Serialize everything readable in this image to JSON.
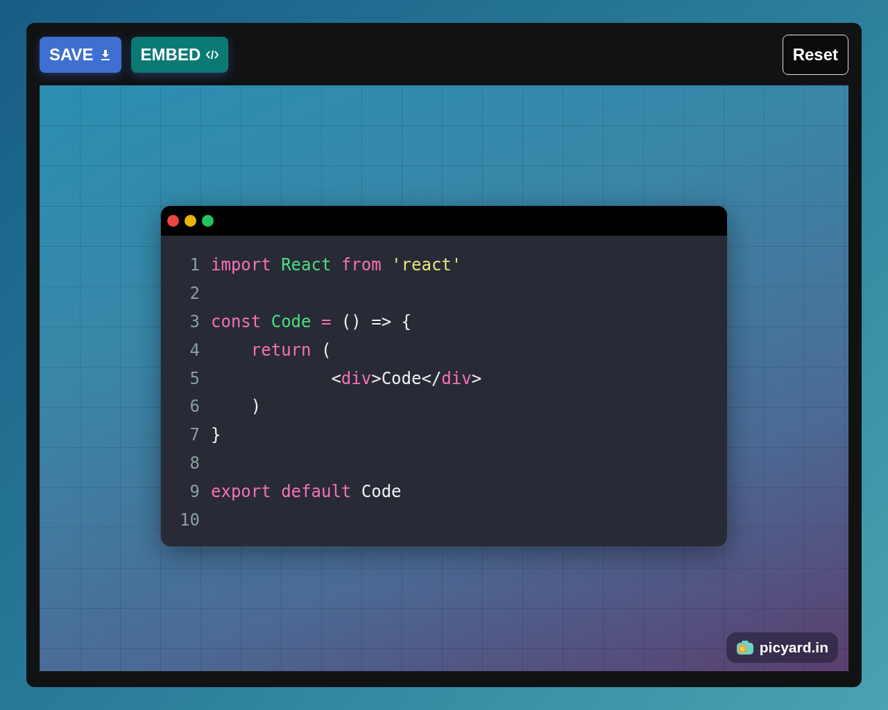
{
  "toolbar": {
    "buttons": [
      {
        "label": "SAVE",
        "kind": "save"
      },
      {
        "label": "EMBED",
        "kind": "embed"
      }
    ],
    "reset": "Reset"
  },
  "code_window": {
    "lines": [
      {
        "number": "1",
        "tokens": [
          {
            "kind": "keyword",
            "text": "import "
          },
          {
            "kind": "name",
            "text": "React "
          },
          {
            "kind": "keyword",
            "text": "from "
          },
          {
            "kind": "string",
            "text": "'react'"
          }
        ]
      },
      {
        "number": "2"
      },
      {
        "number": "3",
        "tokens": [
          {
            "kind": "keyword",
            "text": "const "
          },
          {
            "kind": "name",
            "text": "Code "
          },
          {
            "kind": "keyword",
            "text": "= "
          },
          {
            "kind": "plain",
            "text": "() => {"
          }
        ]
      },
      {
        "number": "4",
        "tokens": [
          {
            "kind": "keyword",
            "text": "    return "
          },
          {
            "kind": "plain",
            "text": "("
          }
        ]
      },
      {
        "number": "5",
        "tokens": [
          {
            "kind": "plain",
            "text": "            <"
          },
          {
            "kind": "keyword",
            "text": "div"
          },
          {
            "kind": "plain",
            "text": ">Code</"
          },
          {
            "kind": "keyword",
            "text": "div"
          },
          {
            "kind": "plain",
            "text": ">"
          }
        ]
      },
      {
        "number": "6",
        "tokens": [
          {
            "kind": "plain",
            "text": "    )"
          }
        ]
      },
      {
        "number": "7",
        "tokens": [
          {
            "kind": "plain",
            "text": "}"
          }
        ]
      },
      {
        "number": "8"
      },
      {
        "number": "9",
        "tokens": [
          {
            "kind": "keyword",
            "text": "export "
          },
          {
            "kind": "keyword",
            "text": "default "
          },
          {
            "kind": "plain",
            "text": "Code"
          }
        ]
      },
      {
        "number": "10"
      }
    ]
  },
  "badge": {
    "label": "picyard.in"
  }
}
